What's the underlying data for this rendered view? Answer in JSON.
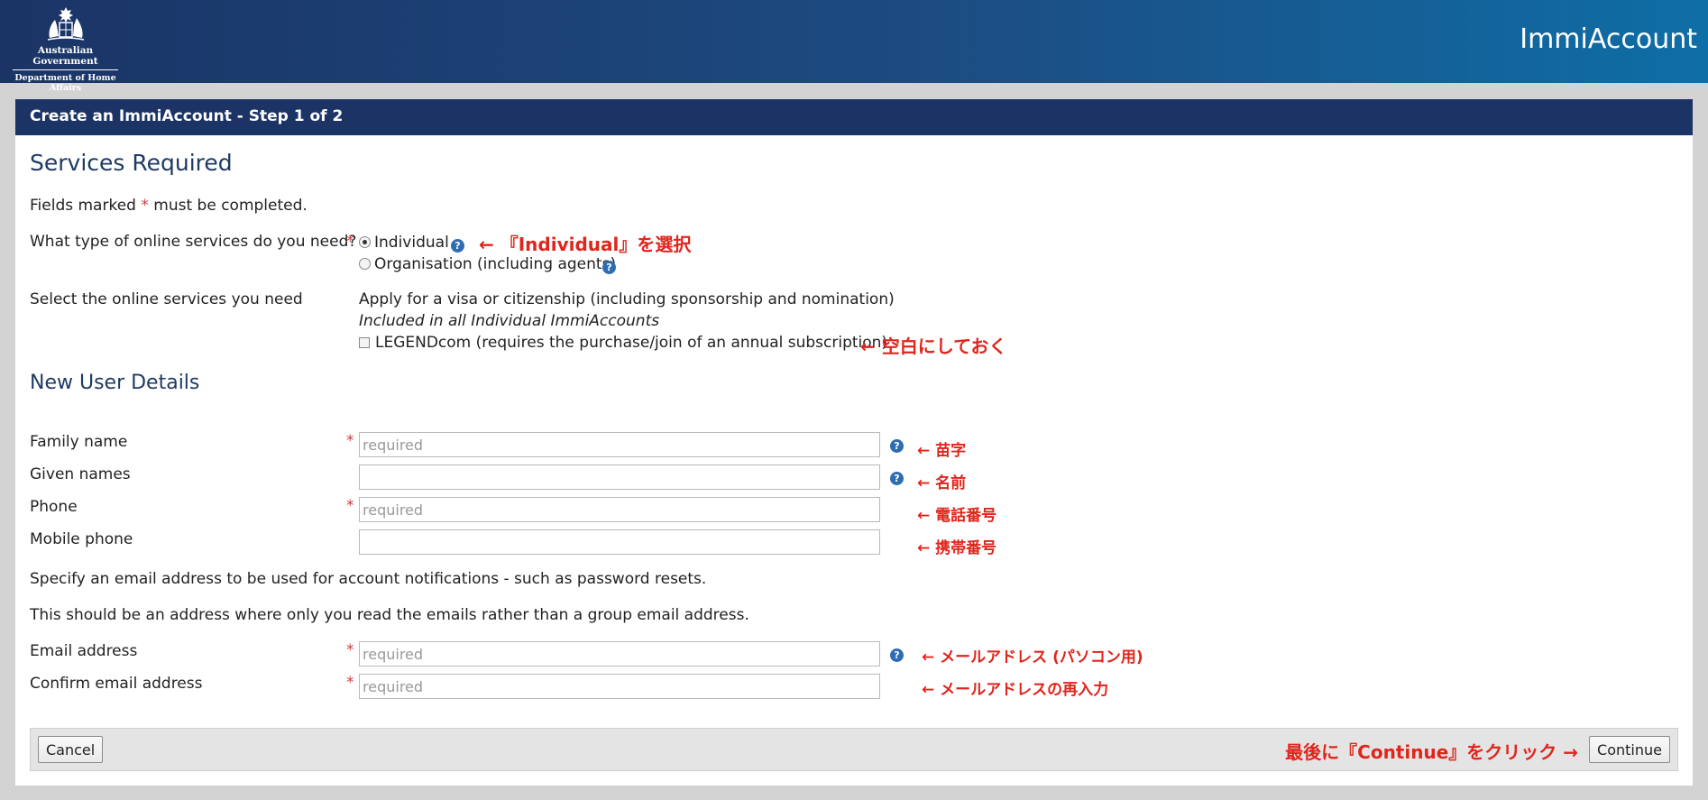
{
  "header": {
    "logo_line1": "Australian Government",
    "logo_line2": "Department of Home Affairs",
    "app_name": "ImmiAccount"
  },
  "panel": {
    "title": "Create an ImmiAccount - Step 1 of 2"
  },
  "services": {
    "heading": "Services Required",
    "fields_note_pre": "Fields marked",
    "fields_note_star": "*",
    "fields_note_post": "must be completed.",
    "type_label": "What type of online services do you need?",
    "type_options": [
      {
        "label": "Individual",
        "selected": true
      },
      {
        "label": "Organisation (including agents)",
        "selected": false
      }
    ],
    "select_label": "Select the online services you need",
    "apply_text": "Apply for a visa or citizenship (including sponsorship and nomination)",
    "included_text": "Included in all Individual ImmiAccounts",
    "legend_label": "LEGENDcom (requires the purchase/join of an annual subscription)",
    "legend_checked": false
  },
  "user": {
    "heading": "New User Details",
    "fields": [
      {
        "label": "Family name",
        "required": true,
        "placeholder": "required",
        "value": ""
      },
      {
        "label": "Given names",
        "required": false,
        "placeholder": "",
        "value": ""
      },
      {
        "label": "Phone",
        "required": true,
        "placeholder": "required",
        "value": ""
      },
      {
        "label": "Mobile phone",
        "required": false,
        "placeholder": "",
        "value": ""
      }
    ],
    "email_note1": "Specify an email address to be used for account notifications - such as password resets.",
    "email_note2": "This should be an address where only you read the emails rather than a group email address.",
    "email_fields": [
      {
        "label": "Email address",
        "required": true,
        "placeholder": "required",
        "value": ""
      },
      {
        "label": "Confirm email address",
        "required": true,
        "placeholder": "required",
        "value": ""
      }
    ]
  },
  "annotations": {
    "individual": "← 『Individual』を選択",
    "legend": "← 空白にしておく",
    "family": "← 苗字",
    "given": "← 名前",
    "phone": "← 電話番号",
    "mobile": "← 携帯番号",
    "email": "← メールアドレス (パソコン用)",
    "confirm": "← メールアドレスの再入力",
    "continue": "最後に『Continue』をクリック →"
  },
  "footer": {
    "cancel_label": "Cancel",
    "continue_label": "Continue"
  },
  "colors": {
    "header_dark": "#1c3465",
    "annotation_red": "#e0251c",
    "required_red": "#d23b3b",
    "help_blue": "#2e6db3"
  }
}
